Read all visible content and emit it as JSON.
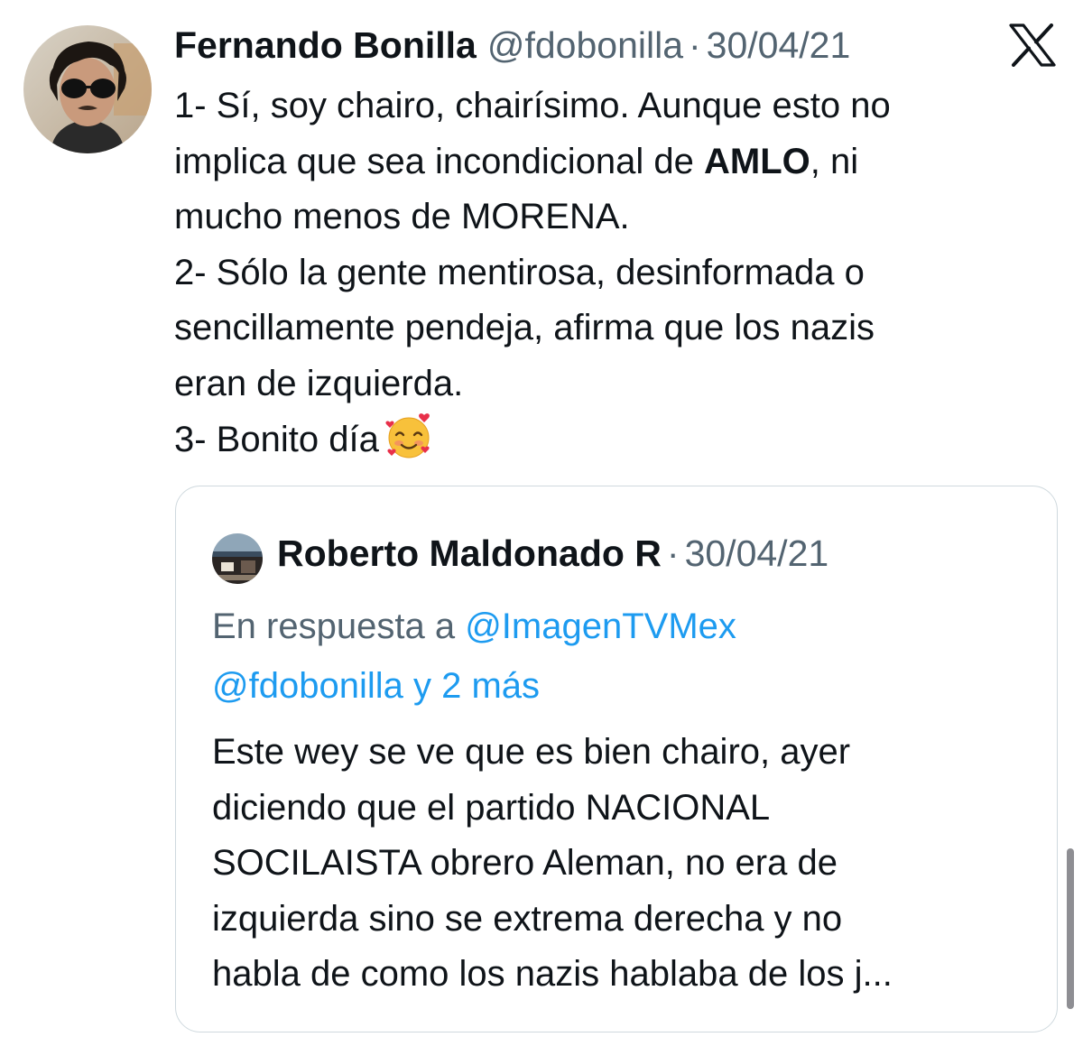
{
  "tweet": {
    "author_name": "Fernando Bonilla",
    "author_handle": "@fdobonilla",
    "separator": "·",
    "date": "30/04/21",
    "platform_icon": "x-logo-icon",
    "body": {
      "l1": "1- Sí, soy chairo, chairísimo. Aunque esto no",
      "l2_pre": "implica que sea incondicional de ",
      "l2_bold": "AMLO",
      "l2_post": ", ni",
      "l3": "mucho menos de MORENA.",
      "l4": "2- Sólo la gente mentirosa, desinformada o",
      "l5": "sencillamente pendeja, afirma que los nazis",
      "l6": "eran de izquierda.",
      "l7": "3- Bonito día",
      "emoji": "smiling-face-with-hearts-emoji"
    }
  },
  "quoted_tweet": {
    "author_name": "Roberto Maldonado R",
    "separator": "·",
    "date": "30/04/21",
    "reply_prefix": "En respuesta a ",
    "reply_mention_1": "@ImagenTVMex",
    "reply_mention_2": "@fdobonilla y 2 más",
    "body": {
      "l1": "Este wey se ve que es bien chairo, ayer",
      "l2": "diciendo que el partido NACIONAL",
      "l3": "SOCILAISTA obrero Aleman, no era de",
      "l4": "izquierda sino se extrema derecha y no",
      "l5": "habla de como los nazis hablaba de los j..."
    }
  },
  "colors": {
    "text_primary": "#0f1419",
    "text_secondary": "#536471",
    "link": "#1d9bf0",
    "border": "#cfd9de"
  }
}
